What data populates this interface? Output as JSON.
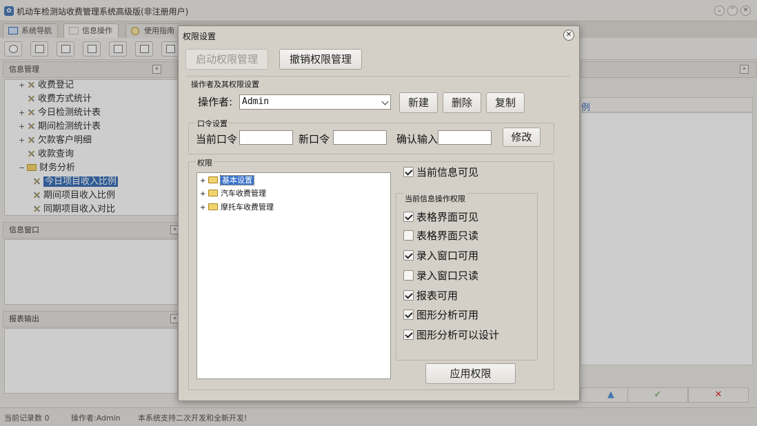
{
  "app": {
    "title": "机动车检测站收费管理系统高级版(非注册用户)",
    "tabs": [
      {
        "label": "系统导航"
      },
      {
        "label": "信息操作"
      },
      {
        "label": "使用指南"
      }
    ]
  },
  "left": {
    "info_mgmt_title": "信息管理",
    "tree": [
      {
        "label": "收费登记",
        "expander": "+"
      },
      {
        "label": "收费方式统计",
        "expander": ""
      },
      {
        "label": "今日检测统计表",
        "expander": "+"
      },
      {
        "label": "期间检测统计表",
        "expander": "+"
      },
      {
        "label": "欠款客户明细",
        "expander": "+"
      },
      {
        "label": "收款查询",
        "expander": ""
      },
      {
        "label": "财务分析",
        "expander": "−"
      },
      {
        "label": "今日项目收入比例",
        "expander": ""
      },
      {
        "label": "期间项目收入比例",
        "expander": ""
      },
      {
        "label": "同期项目收入对比",
        "expander": ""
      }
    ],
    "info_window_title": "信息窗口",
    "report_output_title": "报表输出"
  },
  "right": {
    "grid_header_text": "例"
  },
  "status": {
    "record_count": "当前记录数 0",
    "operator": "操作者:Admin",
    "message": "本系统支持二次开发和全新开发!"
  },
  "dialog": {
    "title": "权限设置",
    "enable_btn": "启动权限管理",
    "revoke_btn": "撤销权限管理",
    "operator_group": "操作者及其权限设置",
    "operator_label": "操作者:",
    "operator_value": "Admin",
    "new_btn": "新建",
    "delete_btn": "删除",
    "copy_btn": "复制",
    "password_group": "口令设置",
    "current_pwd_label": "当前口令",
    "new_pwd_label": "新口令",
    "confirm_label": "确认输入",
    "modify_btn": "修改",
    "permission_group": "权限",
    "perm_tree": [
      {
        "label": "基本设置",
        "expander": "+"
      },
      {
        "label": "汽车收费管理",
        "expander": "+"
      },
      {
        "label": "摩托车收费管理",
        "expander": "+"
      }
    ],
    "current_visible_label": "当前信息可见",
    "current_visible_checked": true,
    "ops_group": "当前信息操作权限",
    "ops": [
      {
        "label": "表格界面可见",
        "checked": true
      },
      {
        "label": "表格界面只读",
        "checked": false
      },
      {
        "label": "录入窗口可用",
        "checked": true
      },
      {
        "label": "录入窗口只读",
        "checked": false
      },
      {
        "label": "报表可用",
        "checked": true
      },
      {
        "label": "图形分析可用",
        "checked": true
      },
      {
        "label": "图形分析可以设计",
        "checked": true
      }
    ],
    "apply_btn": "应用权限"
  }
}
